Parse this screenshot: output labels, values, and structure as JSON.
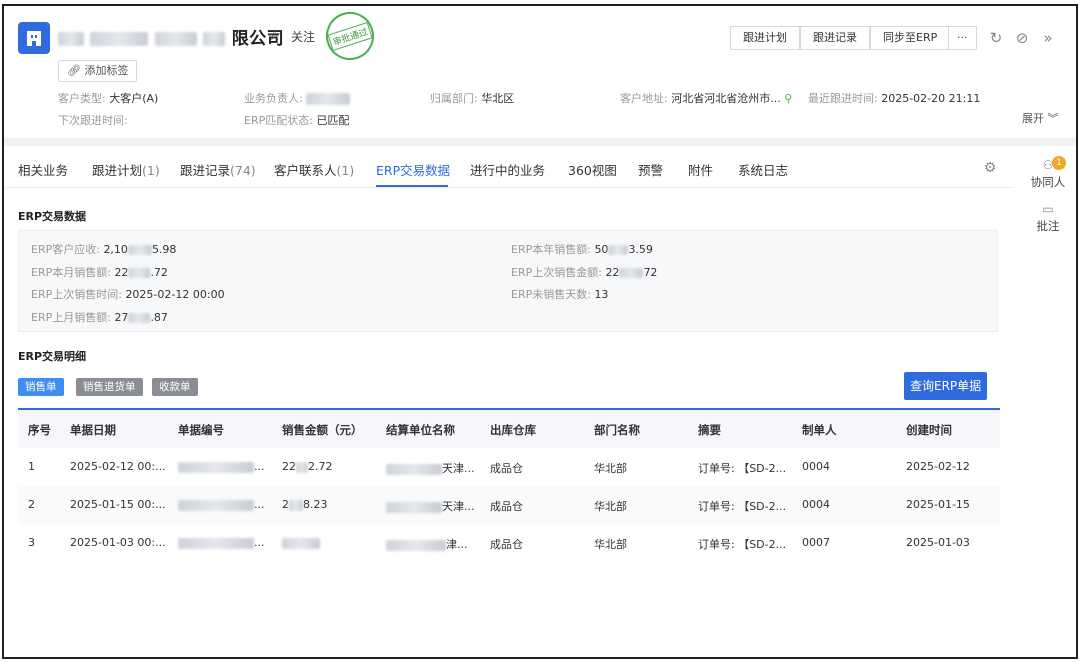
{
  "header": {
    "company_suffix": "限公司",
    "follow_label": "关注",
    "stamp_text": "审批通过",
    "add_tag_label": "添加标签",
    "customer_type_label": "客户类型:",
    "customer_type_value": "大客户(A)",
    "next_follow_label": "下次跟进时间:",
    "owner_label": "业务负责人:",
    "erp_match_label": "ERP匹配状态:",
    "erp_match_value": "已匹配",
    "dept_label": "归属部门:",
    "dept_value": "华北区",
    "address_label": "客户地址:",
    "address_value": "河北省河北省沧州市...",
    "last_follow_label": "最近跟进时间:",
    "last_follow_value": "2025-02-20 21:11",
    "expand_label": "展开"
  },
  "toolbar": {
    "follow_plan": "跟进计划",
    "follow_record": "跟进记录",
    "sync_erp": "同步至ERP",
    "more": "···"
  },
  "tabs": [
    {
      "label": "相关业务",
      "count": ""
    },
    {
      "label": "跟进计划",
      "count": "(1)"
    },
    {
      "label": "跟进记录",
      "count": "(74)"
    },
    {
      "label": "客户联系人",
      "count": "(1)"
    },
    {
      "label": "ERP交易数据",
      "count": ""
    },
    {
      "label": "进行中的业务",
      "count": ""
    },
    {
      "label": "360视图",
      "count": ""
    },
    {
      "label": "预警",
      "count": ""
    },
    {
      "label": "附件",
      "count": ""
    },
    {
      "label": "系统日志",
      "count": ""
    }
  ],
  "erp_summary": {
    "title": "ERP交易数据",
    "receivable_label": "ERP客户应收:",
    "receivable_a": "2,10",
    "receivable_b": "5.98",
    "month_sales_label": "ERP本月销售额:",
    "month_sales_a": "22",
    "month_sales_b": ".72",
    "last_sale_time_label": "ERP上次销售时间:",
    "last_sale_time_value": "2025-02-12 00:00",
    "last_month_sales_label": "ERP上月销售额:",
    "last_month_sales_a": "27",
    "last_month_sales_b": ".87",
    "year_sales_label": "ERP本年销售额:",
    "year_sales_a": "50",
    "year_sales_b": "3.59",
    "last_sale_amount_label": "ERP上次销售金额:",
    "last_sale_amount_a": "22",
    "last_sale_amount_b": "72",
    "no_sale_days_label": "ERP未销售天数:",
    "no_sale_days_value": "13"
  },
  "detail": {
    "title": "ERP交易明细",
    "filters": [
      "销售单",
      "销售退货单",
      "收款单"
    ],
    "query_label": "查询ERP单据",
    "columns": [
      "序号",
      "单据日期",
      "单据编号",
      "销售金额（元）",
      "结算单位名称",
      "出库仓库",
      "部门名称",
      "摘要",
      "制单人",
      "创建时间"
    ],
    "rows": [
      {
        "no": "1",
        "date": "2025-02-12 00:...",
        "doc_tail": "...",
        "amount_a": "22",
        "amount_b": "2.72",
        "settle_tail": "天津...",
        "warehouse": "成品仓",
        "dept": "华北部",
        "summary": "订单号: 【SD-2...",
        "creator": "0004",
        "created": "2025-02-12"
      },
      {
        "no": "2",
        "date": "2025-01-15 00:...",
        "doc_tail": "...",
        "amount_a": "2",
        "amount_b": "8.23",
        "settle_tail": "天津...",
        "warehouse": "成品仓",
        "dept": "华北部",
        "summary": "订单号: 【SD-2...",
        "creator": "0004",
        "created": "2025-01-15"
      },
      {
        "no": "3",
        "date": "2025-01-03 00:...",
        "doc_tail": "...",
        "amount_a": "",
        "amount_b": "",
        "settle_tail": "津...",
        "warehouse": "成品仓",
        "dept": "华北部",
        "summary": "订单号: 【SD-2...",
        "creator": "0007",
        "created": "2025-01-03"
      }
    ]
  },
  "rail": {
    "collaborators_label": "协同人",
    "collaborators_badge": "1",
    "comments_label": "批注"
  },
  "colors": {
    "accent": "#2f6bdc",
    "stamp": "#4caf50",
    "badge": "#f5a623"
  }
}
